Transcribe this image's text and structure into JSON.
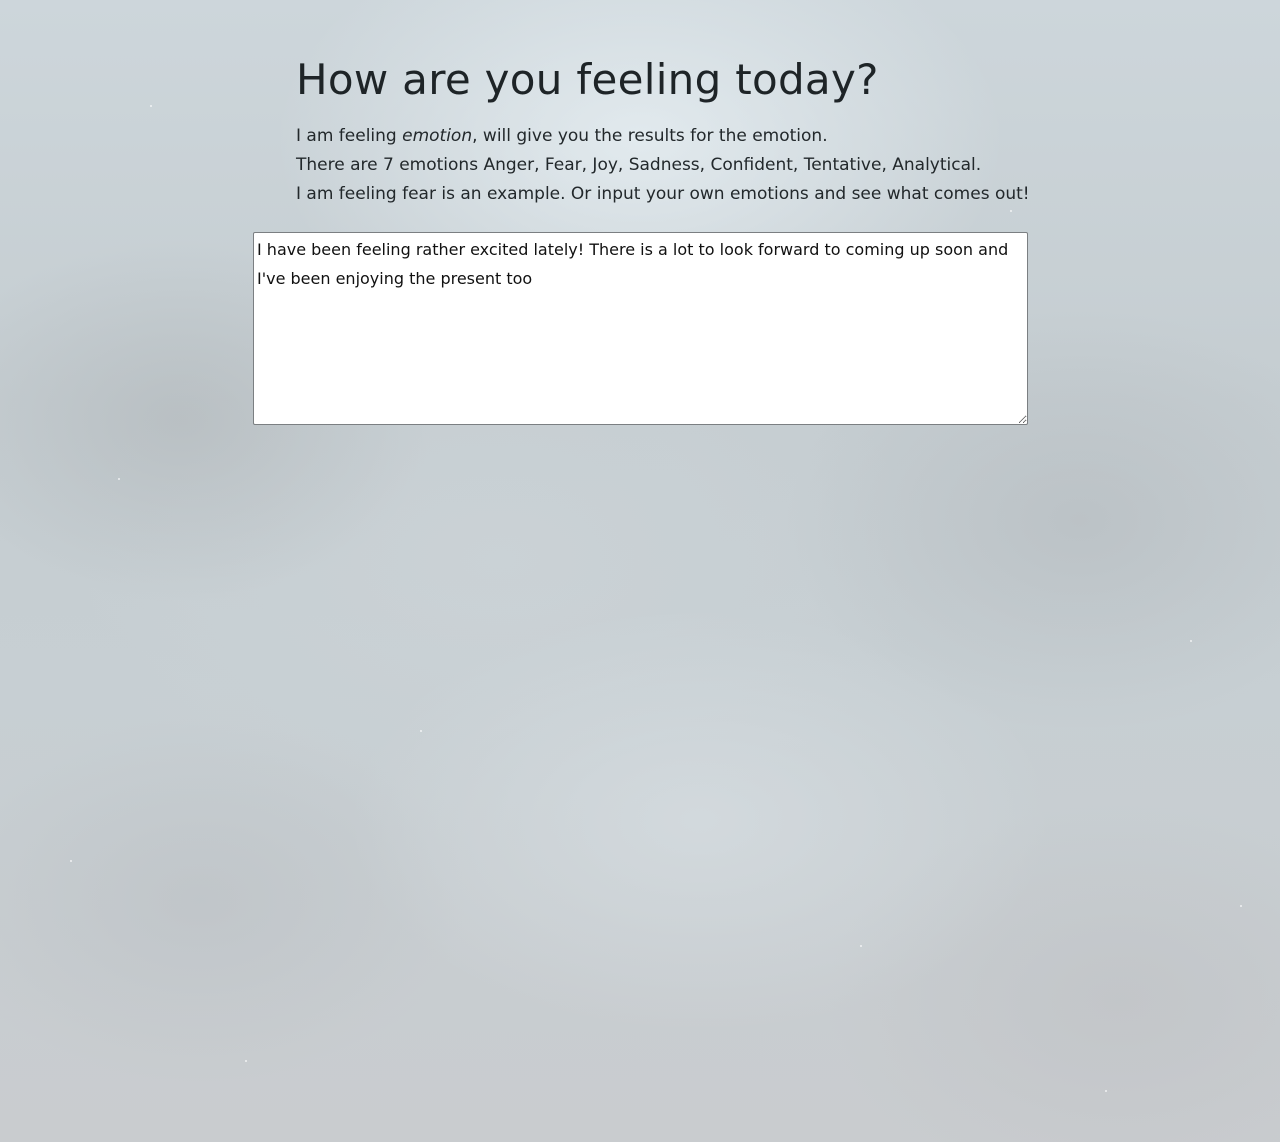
{
  "page": {
    "title": "How are you feeling today?",
    "intro": {
      "line1_prefix": "I am feeling ",
      "line1_emphasis": "emotion",
      "line1_suffix": ", will give you the results for the emotion.",
      "line2": "There are 7 emotions Anger, Fear, Joy, Sadness, Confident, Tentative, Analytical.",
      "line3": "I am feeling fear is an example. Or input your own emotions and see what comes out!"
    },
    "entry": {
      "value": "I have been feeling rather excited lately! There is a lot to look forward to coming up soon and I've been enjoying the present too"
    }
  }
}
